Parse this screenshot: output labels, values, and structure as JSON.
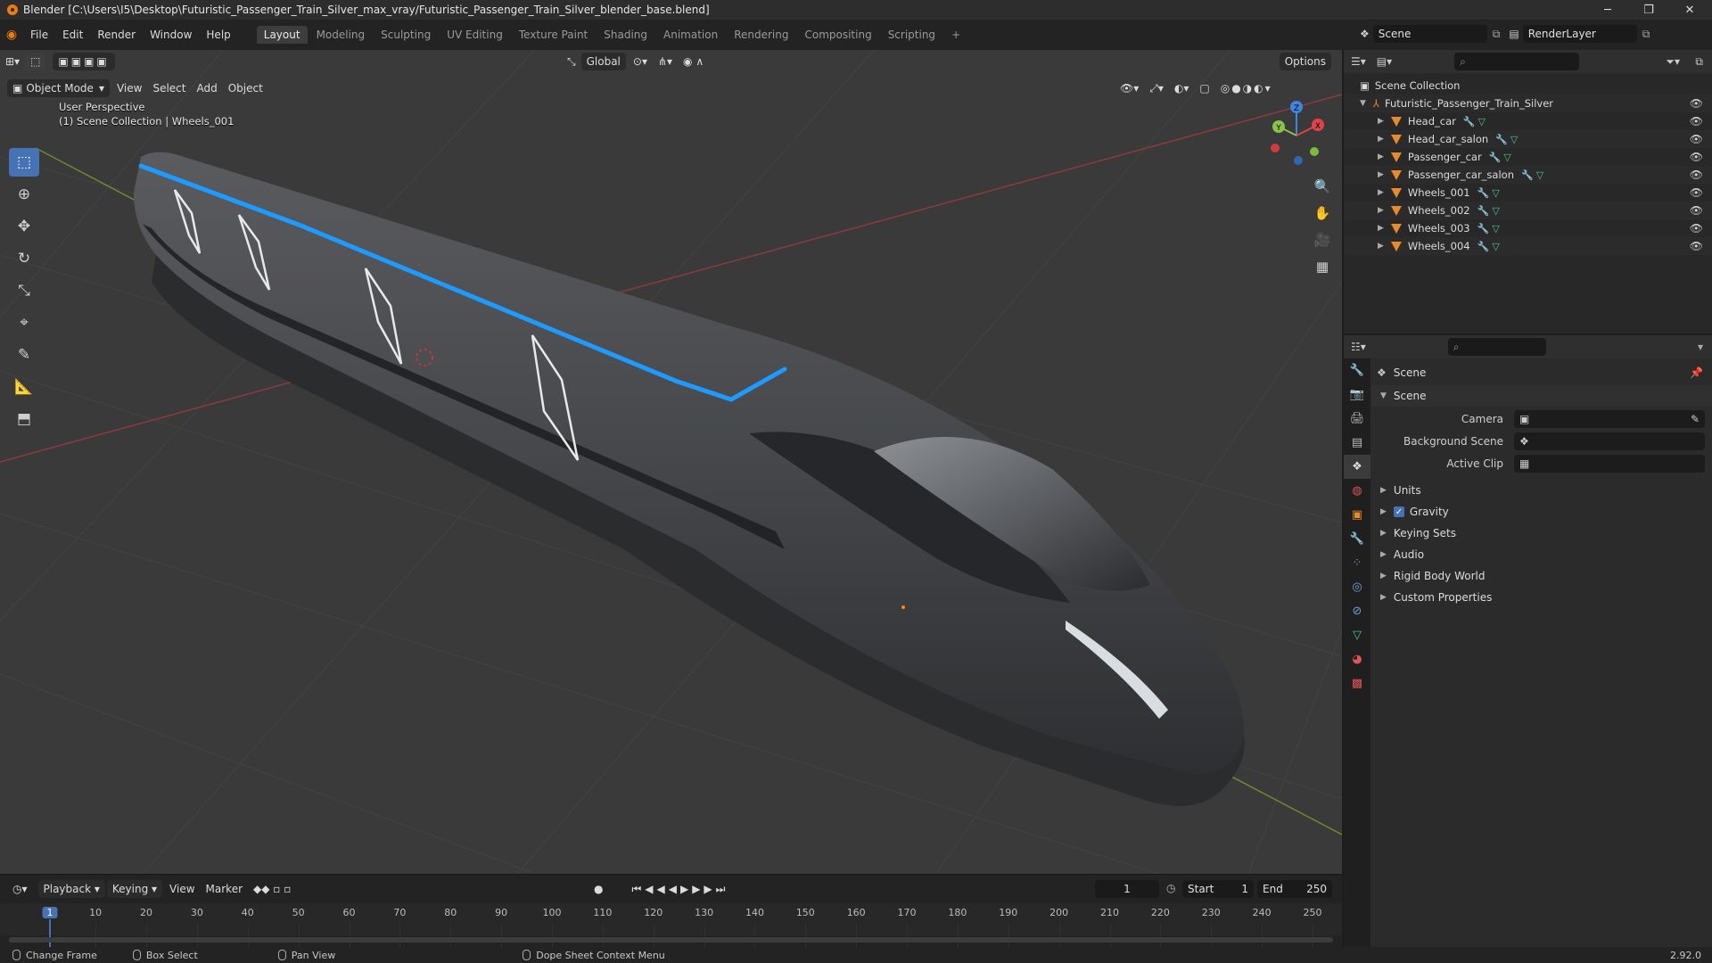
{
  "window": {
    "title": "Blender [C:\\Users\\I5\\Desktop\\Futuristic_Passenger_Train_Silver_max_vray/Futuristic_Passenger_Train_Silver_blender_base.blend]",
    "minimize": "─",
    "maximize": "❐",
    "close": "✕"
  },
  "menu": [
    "File",
    "Edit",
    "Render",
    "Window",
    "Help"
  ],
  "workspaces": [
    "Layout",
    "Modeling",
    "Sculpting",
    "UV Editing",
    "Texture Paint",
    "Shading",
    "Animation",
    "Rendering",
    "Compositing",
    "Scripting"
  ],
  "workspace_add": "+",
  "active_workspace": "Layout",
  "top_right": {
    "scene": "Scene",
    "render_layer": "RenderLayer"
  },
  "viewport": {
    "transform_orientation": "Global",
    "options_label": "Options",
    "mode": "Object Mode",
    "menus": [
      "View",
      "Select",
      "Add",
      "Object"
    ],
    "overlay_line1": "User Perspective",
    "overlay_line2": "(1) Scene Collection | Wheels_001",
    "gizmo": {
      "x": "X",
      "y": "Y",
      "z": "Z"
    }
  },
  "outliner": {
    "root": "Scene Collection",
    "collection": "Futuristic_Passenger_Train_Silver",
    "objects": [
      "Head_car",
      "Head_car_salon",
      "Passenger_car",
      "Passenger_car_salon",
      "Wheels_001",
      "Wheels_002",
      "Wheels_003",
      "Wheels_004"
    ]
  },
  "properties": {
    "context": "Scene",
    "panel_title": "Scene",
    "fields": [
      {
        "label": "Camera",
        "value": ""
      },
      {
        "label": "Background Scene",
        "value": ""
      },
      {
        "label": "Active Clip",
        "value": ""
      }
    ],
    "subpanels": [
      "Units",
      "Gravity",
      "Keying Sets",
      "Audio",
      "Rigid Body World",
      "Custom Properties"
    ],
    "gravity_enabled": true
  },
  "timeline": {
    "menus": [
      "Playback",
      "Keying",
      "View",
      "Marker"
    ],
    "current_frame": "1",
    "start_label": "Start",
    "start": "1",
    "end_label": "End",
    "end": "250",
    "ticks": [
      "1",
      "10",
      "20",
      "30",
      "40",
      "50",
      "60",
      "70",
      "80",
      "90",
      "100",
      "110",
      "120",
      "130",
      "140",
      "150",
      "160",
      "170",
      "180",
      "190",
      "200",
      "210",
      "220",
      "230",
      "240",
      "250"
    ]
  },
  "statusbar": {
    "items": [
      "Change Frame",
      "Box Select",
      "Pan View",
      "Dope Sheet Context Menu"
    ],
    "version": "2.92.0"
  },
  "colors": {
    "accent": "#4772b3",
    "train_stripe": "#1e9bff",
    "axis_x": "#e0444a",
    "axis_y": "#8bc34a",
    "axis_z": "#3f86e0"
  }
}
